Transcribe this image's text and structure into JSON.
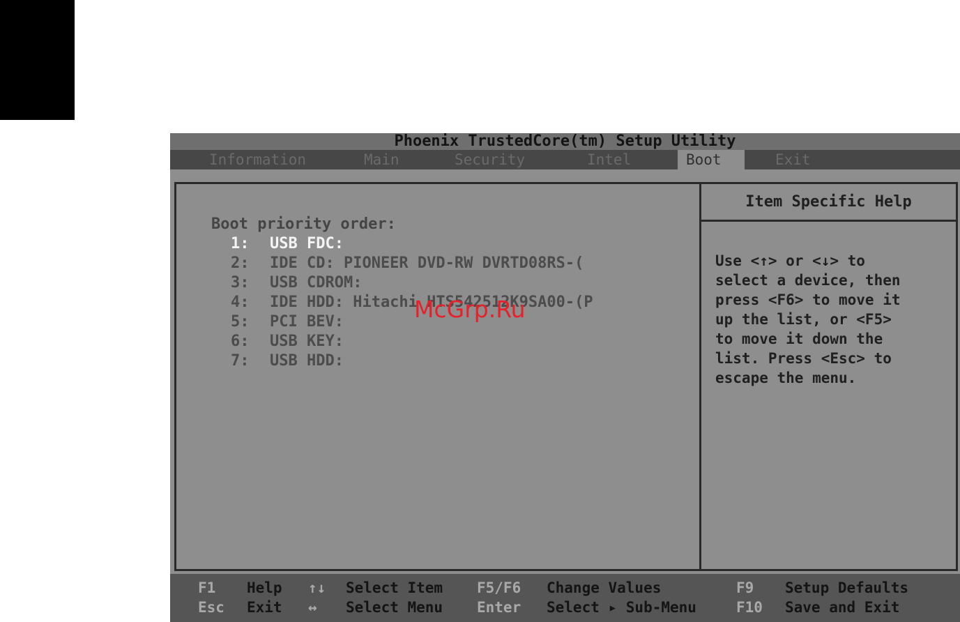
{
  "title": "Phoenix TrustedCore(tm) Setup Utility",
  "menu": {
    "tabs": [
      {
        "label": "Information"
      },
      {
        "label": "Main"
      },
      {
        "label": "Security"
      },
      {
        "label": "Intel"
      },
      {
        "label": "Boot"
      },
      {
        "label": "Exit"
      }
    ],
    "active": "Boot"
  },
  "boot": {
    "heading": "Boot priority order:",
    "items": [
      {
        "num": "1:",
        "label": "USB FDC:"
      },
      {
        "num": "2:",
        "label": "IDE CD: PIONEER DVD-RW DVRTD08RS-("
      },
      {
        "num": "3:",
        "label": "USB CDROM:"
      },
      {
        "num": "4:",
        "label": "IDE HDD: Hitachi HTS542512K9SA00-(P"
      },
      {
        "num": "5:",
        "label": "PCI BEV:"
      },
      {
        "num": "6:",
        "label": "USB KEY:"
      },
      {
        "num": "7:",
        "label": "USB HDD:"
      }
    ],
    "selected_index": 0
  },
  "help": {
    "title": "Item Specific Help",
    "text": "Use <↑> or <↓> to\nselect a device, then\npress <F6> to move it\nup the list, or <F5>\nto move it down the\nlist. Press <Esc> to\nescape the menu."
  },
  "status": {
    "f1_key": "F1",
    "f1_label": "Help",
    "esc_key": "Esc",
    "esc_label": "Exit",
    "updown_key": "↑↓",
    "updown_label": "Select Item",
    "leftright_key": "↔",
    "leftright_label": "Select Menu",
    "f5f6_key": "F5/F6",
    "f5f6_label": "Change Values",
    "enter_key": "Enter",
    "enter_label": "Select ▸ Sub-Menu",
    "f9_key": "F9",
    "f9_label": "Setup Defaults",
    "f10_key": "F10",
    "f10_label": "Save and Exit"
  },
  "watermark": "McGrp.Ru"
}
